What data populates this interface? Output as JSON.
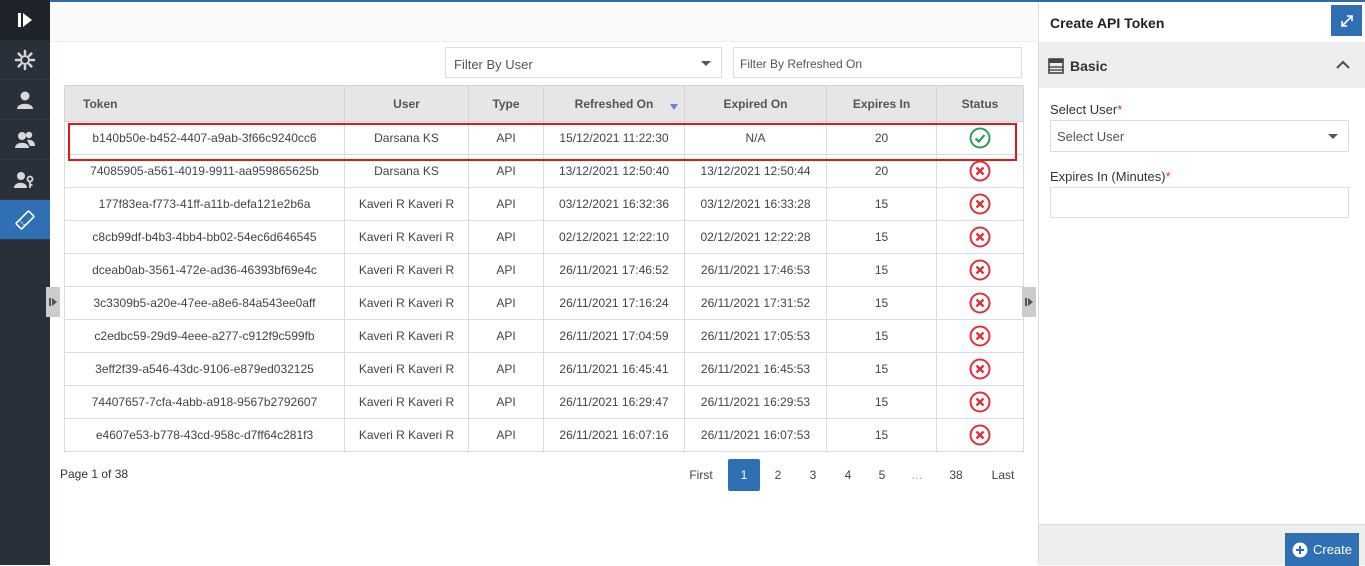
{
  "filters": {
    "user_placeholder": "Filter By User",
    "refreshed_placeholder": "Filter By Refreshed On"
  },
  "table": {
    "headers": [
      "Token",
      "User",
      "Type",
      "Refreshed On",
      "Expired On",
      "Expires In",
      "Status"
    ],
    "rows": [
      [
        "b140b50e-b452-4407-a9ab-3f66c9240cc6",
        "Darsana KS",
        "API",
        "15/12/2021 11:22:30",
        "N/A",
        "20",
        "active"
      ],
      [
        "74085905-a561-4019-9911-aa959865625b",
        "Darsana KS",
        "API",
        "13/12/2021 12:50:40",
        "13/12/2021 12:50:44",
        "20",
        "expired"
      ],
      [
        "177f83ea-f773-41ff-a11b-defa121e2b6a",
        "Kaveri R Kaveri R",
        "API",
        "03/12/2021 16:32:36",
        "03/12/2021 16:33:28",
        "15",
        "expired"
      ],
      [
        "c8cb99df-b4b3-4bb4-bb02-54ec6d646545",
        "Kaveri R Kaveri R",
        "API",
        "02/12/2021 12:22:10",
        "02/12/2021 12:22:28",
        "15",
        "expired"
      ],
      [
        "dceab0ab-3561-472e-ad36-46393bf69e4c",
        "Kaveri R Kaveri R",
        "API",
        "26/11/2021 17:46:52",
        "26/11/2021 17:46:53",
        "15",
        "expired"
      ],
      [
        "3c3309b5-a20e-47ee-a8e6-84a543ee0aff",
        "Kaveri R Kaveri R",
        "API",
        "26/11/2021 17:16:24",
        "26/11/2021 17:31:52",
        "15",
        "expired"
      ],
      [
        "c2edbc59-29d9-4eee-a277-c912f9c599fb",
        "Kaveri R Kaveri R",
        "API",
        "26/11/2021 17:04:59",
        "26/11/2021 17:05:53",
        "15",
        "expired"
      ],
      [
        "3eff2f39-a546-43dc-9106-e879ed032125",
        "Kaveri R Kaveri R",
        "API",
        "26/11/2021 16:45:41",
        "26/11/2021 16:45:53",
        "15",
        "expired"
      ],
      [
        "74407657-7cfa-4abb-a918-9567b2792607",
        "Kaveri R Kaveri R",
        "API",
        "26/11/2021 16:29:47",
        "26/11/2021 16:29:53",
        "15",
        "expired"
      ],
      [
        "e4607e53-b778-43cd-958c-d7ff64c281f3",
        "Kaveri R Kaveri R",
        "API",
        "26/11/2021 16:07:16",
        "26/11/2021 16:07:53",
        "15",
        "expired"
      ]
    ]
  },
  "pagination": {
    "label": "Page 1 of 38",
    "first": "First",
    "pages": [
      "1",
      "2",
      "3",
      "4",
      "5",
      "…",
      "38"
    ],
    "last": "Last",
    "current": "1"
  },
  "panel": {
    "title": "Create API Token",
    "section": "Basic",
    "select_user_label": "Select User",
    "select_user_placeholder": "Select User",
    "expires_label": "Expires In (Minutes)",
    "required_mark": "*",
    "create_label": "Create"
  },
  "colors": {
    "accent": "#2f6fb3",
    "nav_bg": "#2a3039",
    "active_status": "#2e9e5b",
    "expired_status": "#e0303a",
    "highlight": "#e01818"
  },
  "icons": {
    "nav": [
      "expand-nav-icon",
      "settings-icon",
      "user-icon",
      "users-group-icon",
      "user-key-icon",
      "token-ticket-icon"
    ]
  }
}
